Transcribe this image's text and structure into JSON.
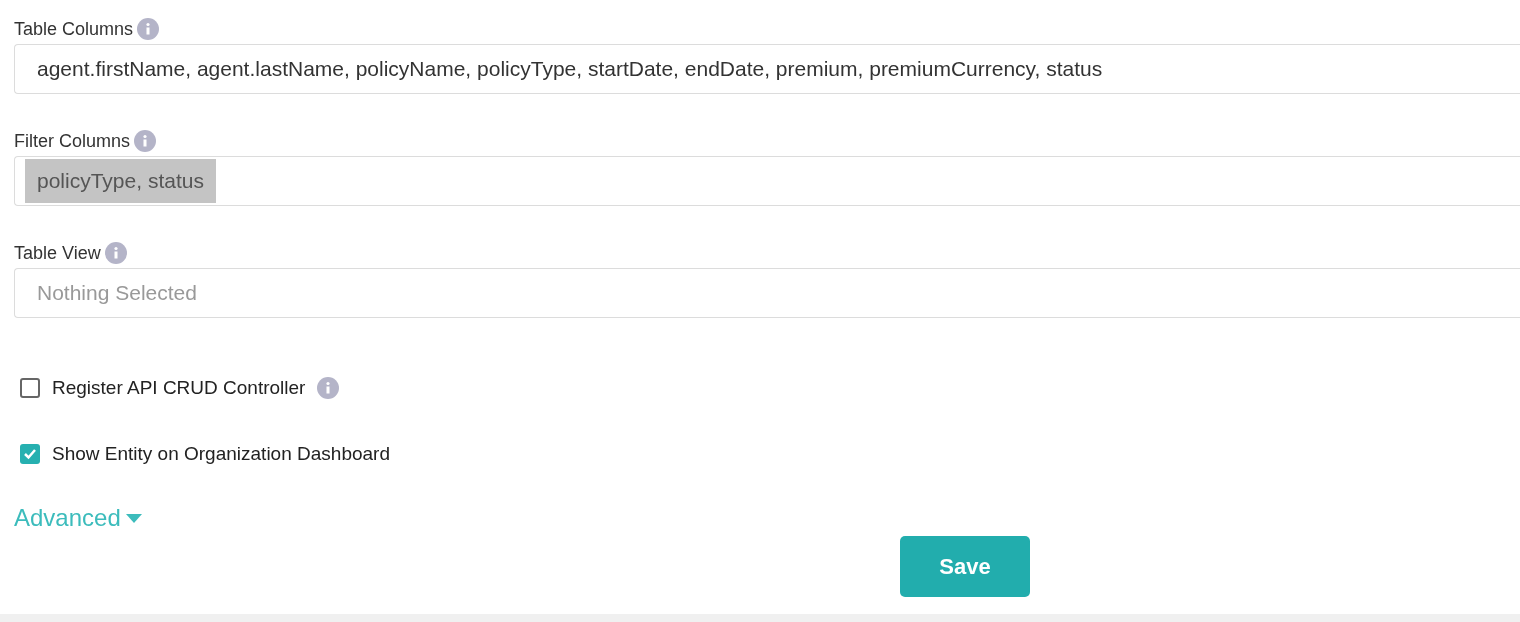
{
  "fields": [
    {
      "label": "Table Columns",
      "value": "agent.firstName, agent.lastName, policyName, policyType, startDate, endDate, premium, premiumCurrency, status"
    },
    {
      "label": "Filter Columns",
      "value": "policyType, status",
      "highlighted": true
    },
    {
      "label": "Table View",
      "placeholder": "Nothing Selected"
    }
  ],
  "checkboxes": [
    {
      "label": "Register API CRUD Controller",
      "checked": false,
      "info": true
    },
    {
      "label": "Show Entity on Organization Dashboard",
      "checked": true,
      "info": false
    }
  ],
  "advanced": {
    "label": "Advanced",
    "expanded": false
  },
  "save_button": "Save"
}
